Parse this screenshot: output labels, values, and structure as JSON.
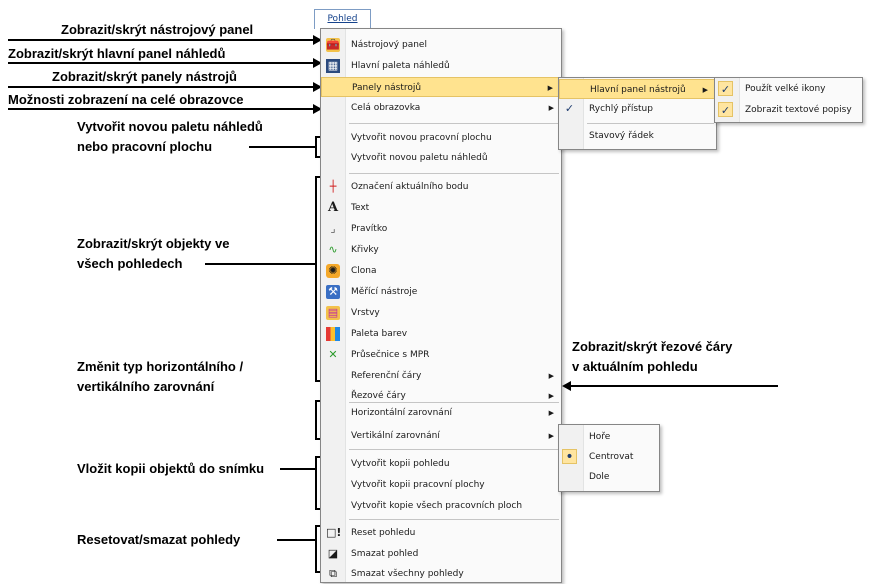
{
  "menubar": {
    "tab_label": "Pohled"
  },
  "callouts": [
    "Zobrazit/skrýt nástrojový panel",
    "Zobrazit/skrýt hlavní panel náhledů",
    "Zobrazit/skrýt panely nástrojů",
    "Možnosti zobrazení na celé obrazovce",
    "Vytvořit novou paletu náhledů",
    "nebo pracovní plochu",
    "Zobrazit/skrýt objekty ve",
    "všech pohledech",
    "Změnit typ horizontálního /",
    "vertikálního zarovnání",
    "Vložit kopii objektů do snímku",
    "Resetovat/smazat pohledy",
    "Zobrazit/skrýt řezové čáry",
    "v aktuálním pohledu"
  ],
  "main_menu": {
    "items": [
      {
        "label": "Nástrojový panel",
        "icon": "toolbox-icon"
      },
      {
        "label": "Hlavní paleta náhledů",
        "icon": "thumbnails-icon"
      },
      {
        "label": "Panely nástrojů",
        "submenu": true,
        "highlighted": true
      },
      {
        "label": "Celá obrazovka",
        "submenu": true
      },
      {
        "label": "Vytvořit novou pracovní plochu"
      },
      {
        "label": "Vytvořit novou paletu náhledů"
      },
      {
        "label": "Označení aktuálního bodu",
        "icon": "crosshair-icon"
      },
      {
        "label": "Text",
        "icon": "text-icon"
      },
      {
        "label": "Pravítko",
        "icon": "ruler-icon"
      },
      {
        "label": "Křivky",
        "icon": "curve-icon"
      },
      {
        "label": "Clona",
        "icon": "aperture-icon"
      },
      {
        "label": "Měřící nástroje",
        "icon": "measure-icon"
      },
      {
        "label": "Vrstvy",
        "icon": "layers-icon"
      },
      {
        "label": "Paleta barev",
        "icon": "palette-icon"
      },
      {
        "label": "Průsečnice s MPR",
        "icon": "mpr-icon"
      },
      {
        "label": "Referenční čáry",
        "submenu": true
      },
      {
        "label": "Řezové čáry",
        "submenu": true
      },
      {
        "label": "Horizontální zarovnání",
        "submenu": true
      },
      {
        "label": "Vertikální zarovnání",
        "submenu": true
      },
      {
        "label": "Vytvořit kopii pohledu"
      },
      {
        "label": "Vytvořit kopii pracovní plochy"
      },
      {
        "label": "Vytvořit kopie všech pracovních ploch"
      },
      {
        "label": "Reset pohledu",
        "icon": "reset-icon"
      },
      {
        "label": "Smazat pohled",
        "icon": "delete-view-icon"
      },
      {
        "label": "Smazat všechny pohledy",
        "icon": "delete-all-icon"
      }
    ]
  },
  "toolbars_submenu": {
    "items": [
      {
        "label": "Hlavní panel nástrojů",
        "submenu": true,
        "highlighted": true
      },
      {
        "label": "Rychlý přístup",
        "checked": true
      },
      {
        "label": "Stavový řádek"
      }
    ]
  },
  "main_toolbar_submenu": {
    "items": [
      {
        "label": "Použít velké ikony",
        "checked": true
      },
      {
        "label": "Zobrazit textové popisy",
        "checked": true
      }
    ]
  },
  "vertical_align_submenu": {
    "items": [
      {
        "label": "Hoře"
      },
      {
        "label": "Centrovat",
        "selected": true
      },
      {
        "label": "Dole"
      }
    ]
  },
  "glyphs": {
    "submenu_arrow": "▶",
    "check": "✓",
    "bullet": "•"
  }
}
